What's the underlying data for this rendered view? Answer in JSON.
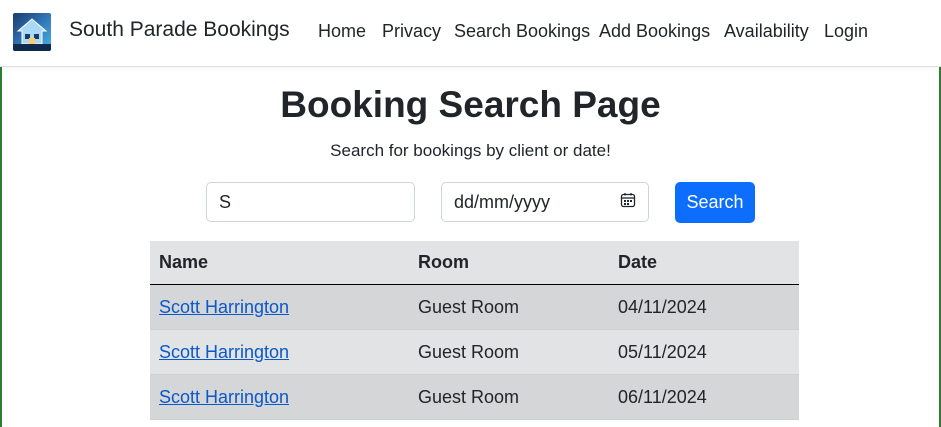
{
  "navbar": {
    "brand": "South Parade Bookings",
    "logo_icon": "house-logo-icon",
    "links": [
      "Home",
      "Privacy",
      "Search Bookings",
      "Add Bookings",
      "Availability",
      "Login"
    ]
  },
  "page": {
    "title": "Booking Search Page",
    "subtitle": "Search for bookings by client or date!"
  },
  "search": {
    "query_value": "S",
    "date_placeholder": "dd/mm/yyyy",
    "date_icon": "calendar-icon",
    "button_label": "Search"
  },
  "table": {
    "headers": [
      "Name",
      "Room",
      "Date"
    ],
    "rows": [
      {
        "name": "Scott Harrington",
        "room": "Guest Room",
        "date": "04/11/2024"
      },
      {
        "name": "Scott Harrington",
        "room": "Guest Room",
        "date": "05/11/2024"
      },
      {
        "name": "Scott Harrington",
        "room": "Guest Room",
        "date": "06/11/2024"
      }
    ]
  },
  "colors": {
    "primary": "#0d6efd",
    "link": "#0a58ca",
    "accent_border": "#2e7d32"
  }
}
